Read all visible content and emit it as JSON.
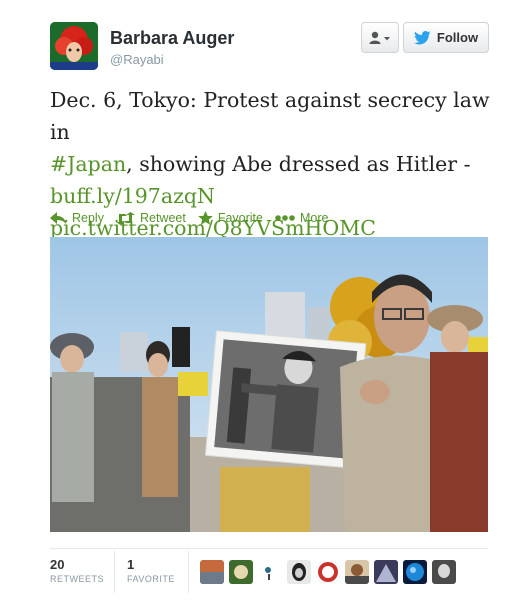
{
  "user": {
    "fullname": "Barbara Auger",
    "screenname": "@Rayabi",
    "follow_label": "Follow"
  },
  "tweet": {
    "text_line1": "Dec. 6, Tokyo: Protest against secrecy law in",
    "hashtag": "#Japan",
    "text_line2_rest": ", showing Abe dressed as Hitler -",
    "link1": "buff.ly/197azqN",
    "link2": "pic.twitter.com/Q8YVSmHOMC"
  },
  "actions": {
    "reply": "Reply",
    "retweet": "Retweet",
    "favorite": "Favorite",
    "more": "More"
  },
  "stats": {
    "retweets_count": "20",
    "retweets_label": "RETWEETS",
    "favorites_count": "1",
    "favorites_label": "FAVORITE"
  },
  "colors": {
    "link": "#57942a",
    "follow_bird": "#2aa3ef"
  },
  "icons": [
    "user-dropdown-icon",
    "twitter-bird-icon",
    "reply-icon",
    "retweet-icon",
    "favorite-star-icon",
    "more-dots-icon"
  ]
}
